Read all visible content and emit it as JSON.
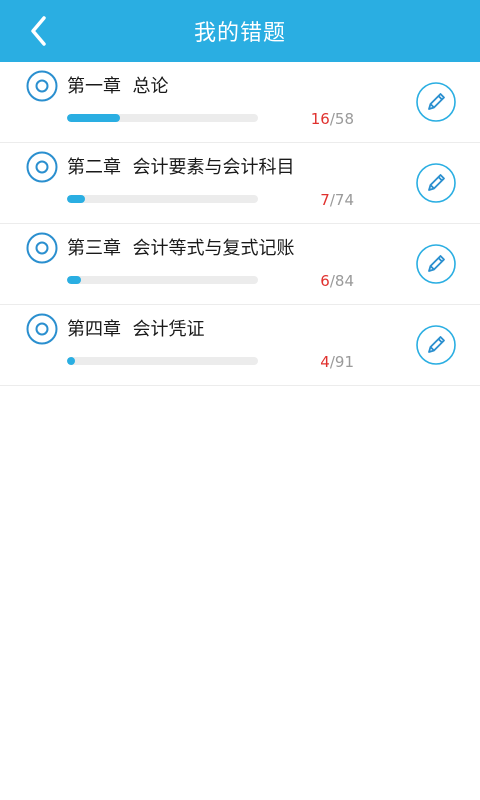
{
  "header": {
    "title": "我的错题",
    "back_icon": "chevron-left-icon",
    "color": "#2aaee2"
  },
  "chapters": [
    {
      "title": "第一章  总论",
      "done": "16",
      "total": "58",
      "progress": 0.276
    },
    {
      "title": "第二章  会计要素与会计科目",
      "done": "7",
      "total": "74",
      "progress": 0.095
    },
    {
      "title": "第三章  会计等式与复式记账",
      "done": "6",
      "total": "84",
      "progress": 0.071
    },
    {
      "title": "第四章  会计凭证",
      "done": "4",
      "total": "91",
      "progress": 0.044
    }
  ],
  "colors": {
    "accent": "#2aaee2",
    "done_count": "#e0312e",
    "total_count": "#9a9a9a"
  },
  "icons": {
    "chapter": "target-circle-icon",
    "edit": "pencil-icon"
  }
}
